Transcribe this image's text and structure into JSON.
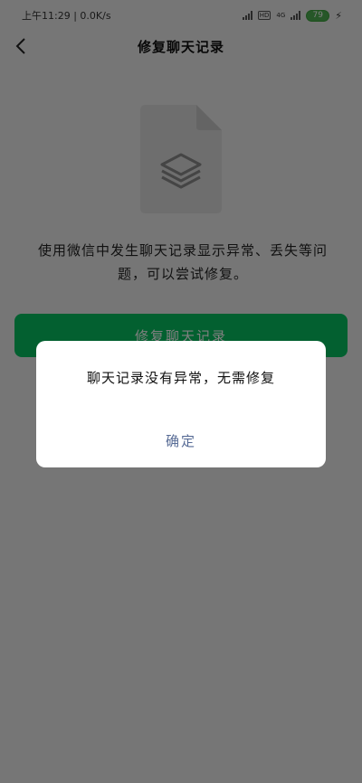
{
  "status_bar": {
    "time": "上午11:29",
    "net_speed": "0.0K/s",
    "net_type": "4G",
    "battery": "79"
  },
  "header": {
    "title": "修复聊天记录",
    "back_icon": "chevron-left-icon"
  },
  "main": {
    "graphic_icon": "layers-document-icon",
    "description": "使用微信中发生聊天记录显示异常、丢失等问题，可以尝试修复。",
    "repair_button_label": "修复聊天记录"
  },
  "dialog": {
    "message": "聊天记录没有异常，无需修复",
    "confirm_label": "确定"
  },
  "colors": {
    "accent": "#07c160",
    "link": "#576b95",
    "background": "#ededed",
    "overlay": "rgba(0,0,0,0.5)"
  }
}
